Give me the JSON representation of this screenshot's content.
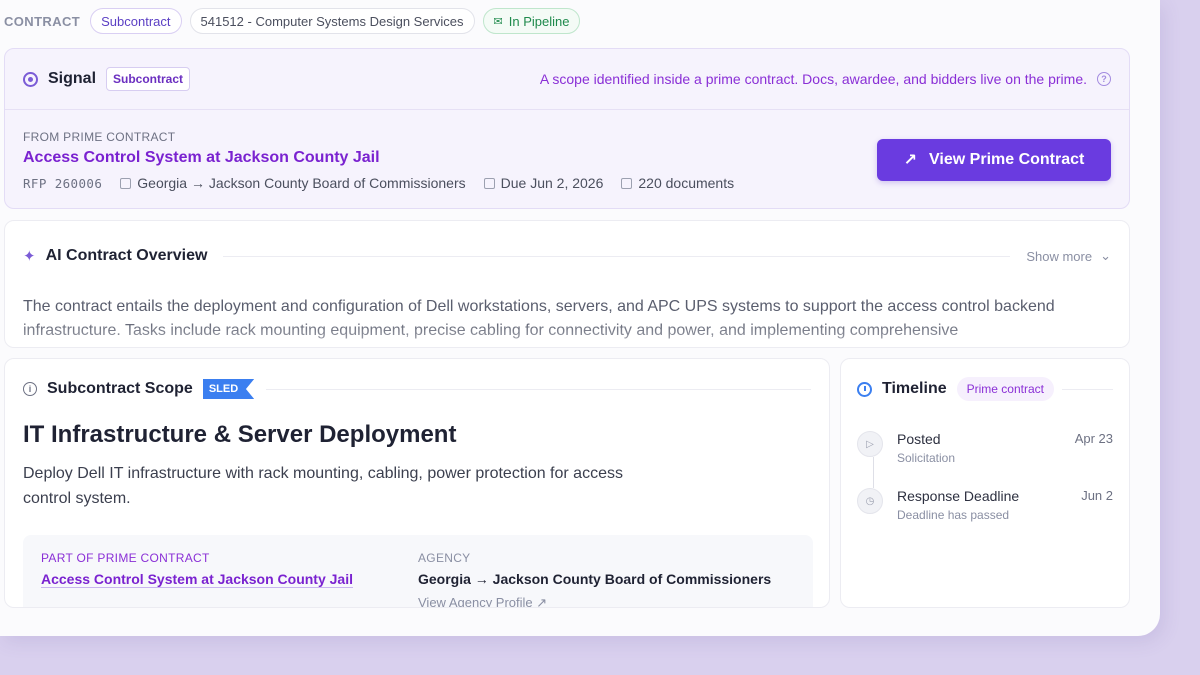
{
  "header": {
    "label": "CONTRACT",
    "chips": {
      "type": "Subcontract",
      "naics": "541512 - Computer Systems Design Services",
      "status": "In Pipeline"
    }
  },
  "signal": {
    "title": "Signal",
    "tag": "Subcontract",
    "note": "A scope identified inside a prime contract. Docs, awardee, and bidders live on the prime.",
    "from_label": "FROM PRIME CONTRACT",
    "prime_title": "Access Control System at Jackson County Jail",
    "rfp": "RFP 260006",
    "location": "Georgia → Jackson County Board of Commissioners",
    "due": "Due Jun 2, 2026",
    "documents": "220 documents",
    "button_label": "View Prime Contract"
  },
  "overview": {
    "title": "AI Contract Overview",
    "show_more": "Show more",
    "text": "The contract entails the deployment and configuration of Dell workstations, servers, and APC UPS systems to support the access control backend infrastructure. Tasks include rack mounting equipment, precise cabling for connectivity and power, and implementing comprehensive"
  },
  "scope": {
    "title": "Subcontract Scope",
    "badge": "SLED",
    "heading": "IT Infrastructure & Server Deployment",
    "description": "Deploy Dell IT infrastructure with rack mounting, cabling, power protection for access control system.",
    "part_label": "PART OF PRIME CONTRACT",
    "part_link": "Access Control System at Jackson County Jail",
    "agency_label": "AGENCY",
    "agency_value": "Georgia → Jackson County Board of Commissioners",
    "agency_link": "View Agency Profile"
  },
  "timeline": {
    "title": "Timeline",
    "tag": "Prime contract",
    "items": [
      {
        "name": "Posted",
        "sub": "Solicitation",
        "date": "Apr 23",
        "icon": "play-icon"
      },
      {
        "name": "Response Deadline",
        "sub": "Deadline has passed",
        "date": "Jun 2",
        "icon": "clock-icon"
      }
    ]
  },
  "colors": {
    "accent": "#6a3be0",
    "purple_text": "#7a22d0",
    "sled_blue": "#3b7ff0",
    "pipeline_green": "#1f8a4c"
  }
}
